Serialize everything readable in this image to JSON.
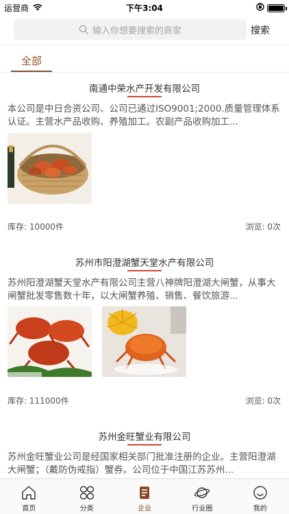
{
  "status_bar": {
    "carrier": "运营商",
    "time": "下午3:04"
  },
  "search": {
    "placeholder": "输入你想要搜索的商家",
    "button_label": "搜索"
  },
  "filter_tabs": {
    "active_label": "全部"
  },
  "companies": [
    {
      "name": "南通中荣水产开发有限公司",
      "description": "本公司是中日合资公司、公司已通过ISO9001;2000.质量管理体系认证。主营水产品收购、养殖加工。农副产品收购加工...",
      "stock": "库存: 10000件",
      "views": "浏览: 0次",
      "images": [
        "crab-basket-photo"
      ]
    },
    {
      "name": "苏州市阳澄湖蟹天堂水产有限公司",
      "description": "苏州阳澄湖蟹天堂水产有限公司主营八神牌阳澄湖大闸蟹，从事大闸蟹批发零售数十年，以大闸蟹养殖、销售、餐饮旅游...",
      "stock": "库存: 111000件",
      "views": "浏览: 0次",
      "images": [
        "cooked-crabs-photo",
        "crab-with-flower-photo"
      ]
    },
    {
      "name": "苏州金旺蟹业有限公司",
      "description": "苏州金旺蟹业公司是经国家相关部门批准注册的企业。主营阳澄湖大闸蟹；（戴防伪戒指）蟹券。公司位于中国江苏苏州...",
      "stock": "",
      "views": "",
      "images": []
    }
  ],
  "tabbar": {
    "items": [
      {
        "label": "首页",
        "icon": "home-icon"
      },
      {
        "label": "分类",
        "icon": "category-icon"
      },
      {
        "label": "企业",
        "icon": "company-icon"
      },
      {
        "label": "行业圈",
        "icon": "planet-icon"
      },
      {
        "label": "我的",
        "icon": "profile-icon"
      }
    ],
    "active_index": 2
  },
  "colors": {
    "accent": "#8a4a2a",
    "title_underline": "#d9432f"
  }
}
